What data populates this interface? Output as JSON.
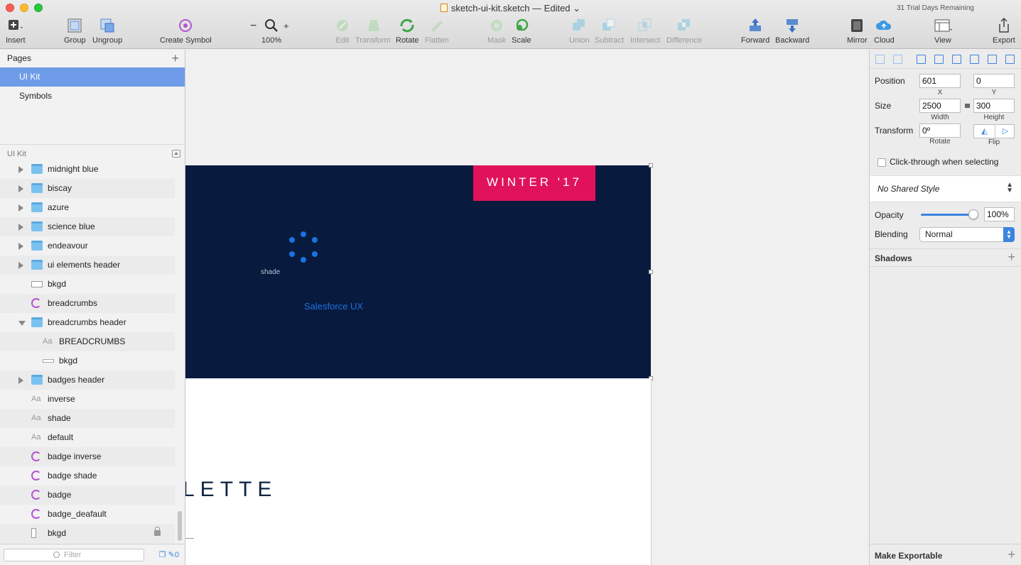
{
  "window": {
    "title": "sketch-ui-kit.sketch — Edited",
    "trial": "31 Trial Days Remaining"
  },
  "toolbar": {
    "insert": "Insert",
    "group": "Group",
    "ungroup": "Ungroup",
    "create_symbol": "Create Symbol",
    "zoom_minus": "−",
    "zoom_value": "100%",
    "zoom_plus": "+",
    "edit": "Edit",
    "transform": "Transform",
    "rotate": "Rotate",
    "flatten": "Flatten",
    "mask": "Mask",
    "scale": "Scale",
    "union": "Union",
    "subtract": "Subtract",
    "intersect": "Intersect",
    "difference": "Difference",
    "forward": "Forward",
    "backward": "Backward",
    "mirror": "Mirror",
    "cloud": "Cloud",
    "view": "View",
    "export": "Export"
  },
  "pages": {
    "header": "Pages",
    "items": [
      {
        "label": "UI Kit"
      },
      {
        "label": "Symbols"
      }
    ]
  },
  "layers": {
    "header": "UI Kit",
    "items": [
      {
        "label": "midnight blue",
        "icon": "folder-icon",
        "indent": 0,
        "disclosure": "right"
      },
      {
        "label": "biscay",
        "icon": "folder-icon",
        "indent": 0,
        "disclosure": "right"
      },
      {
        "label": "azure",
        "icon": "folder-icon",
        "indent": 0,
        "disclosure": "right"
      },
      {
        "label": "science blue",
        "icon": "folder-icon",
        "indent": 0,
        "disclosure": "right"
      },
      {
        "label": "endeavour",
        "icon": "folder-icon",
        "indent": 0,
        "disclosure": "right"
      },
      {
        "label": "ui elements header",
        "icon": "folder-icon",
        "indent": 0,
        "disclosure": "right"
      },
      {
        "label": "bkgd",
        "icon": "rectangle-icon",
        "indent": 0,
        "disclosure": ""
      },
      {
        "label": "breadcrumbs",
        "icon": "symbol-icon",
        "indent": 0,
        "disclosure": ""
      },
      {
        "label": "breadcrumbs header",
        "icon": "folder-icon",
        "indent": 0,
        "disclosure": "down"
      },
      {
        "label": "BREADCRUMBS",
        "icon": "text-icon",
        "indent": 1,
        "disclosure": ""
      },
      {
        "label": "bkgd",
        "icon": "thin-rectangle-icon",
        "indent": 1,
        "disclosure": ""
      },
      {
        "label": "badges header",
        "icon": "folder-icon",
        "indent": 0,
        "disclosure": "right"
      },
      {
        "label": "inverse",
        "icon": "text-icon",
        "indent": 0,
        "disclosure": ""
      },
      {
        "label": "shade",
        "icon": "text-icon",
        "indent": 0,
        "disclosure": ""
      },
      {
        "label": "default",
        "icon": "text-icon",
        "indent": 0,
        "disclosure": ""
      },
      {
        "label": "badge inverse",
        "icon": "symbol-icon",
        "indent": 0,
        "disclosure": ""
      },
      {
        "label": "badge shade",
        "icon": "symbol-icon",
        "indent": 0,
        "disclosure": ""
      },
      {
        "label": "badge",
        "icon": "symbol-icon",
        "indent": 0,
        "disclosure": ""
      },
      {
        "label": "badge_deafault",
        "icon": "symbol-icon",
        "indent": 0,
        "disclosure": ""
      },
      {
        "label": "bkgd",
        "icon": "vertical-rectangle-icon",
        "indent": 0,
        "disclosure": "",
        "locked": true
      }
    ],
    "filter_placeholder": "Filter",
    "filter_count": "0"
  },
  "canvas": {
    "badge_text": "WINTER '17",
    "shade_label": "shade",
    "brand_label": "Salesforce UX",
    "palette_text": "LETTE",
    "colors": {
      "dark": "#081a3d",
      "badge": "#e0135a",
      "accent": "#1b72e0"
    }
  },
  "inspector": {
    "position_label": "Position",
    "x": "601",
    "y": "0",
    "x_label": "X",
    "y_label": "Y",
    "size_label": "Size",
    "width": "2500",
    "height": "300",
    "width_label": "Width",
    "height_label": "Height",
    "transform_label": "Transform",
    "rotate": "0º",
    "rotate_label": "Rotate",
    "flip_label": "Flip",
    "click_through": "Click-through when selecting",
    "shared_style": "No Shared Style",
    "opacity_label": "Opacity",
    "opacity": "100%",
    "opacity_value": 1.0,
    "blending_label": "Blending",
    "blending": "Normal",
    "shadows": "Shadows",
    "make_exportable": "Make Exportable"
  }
}
